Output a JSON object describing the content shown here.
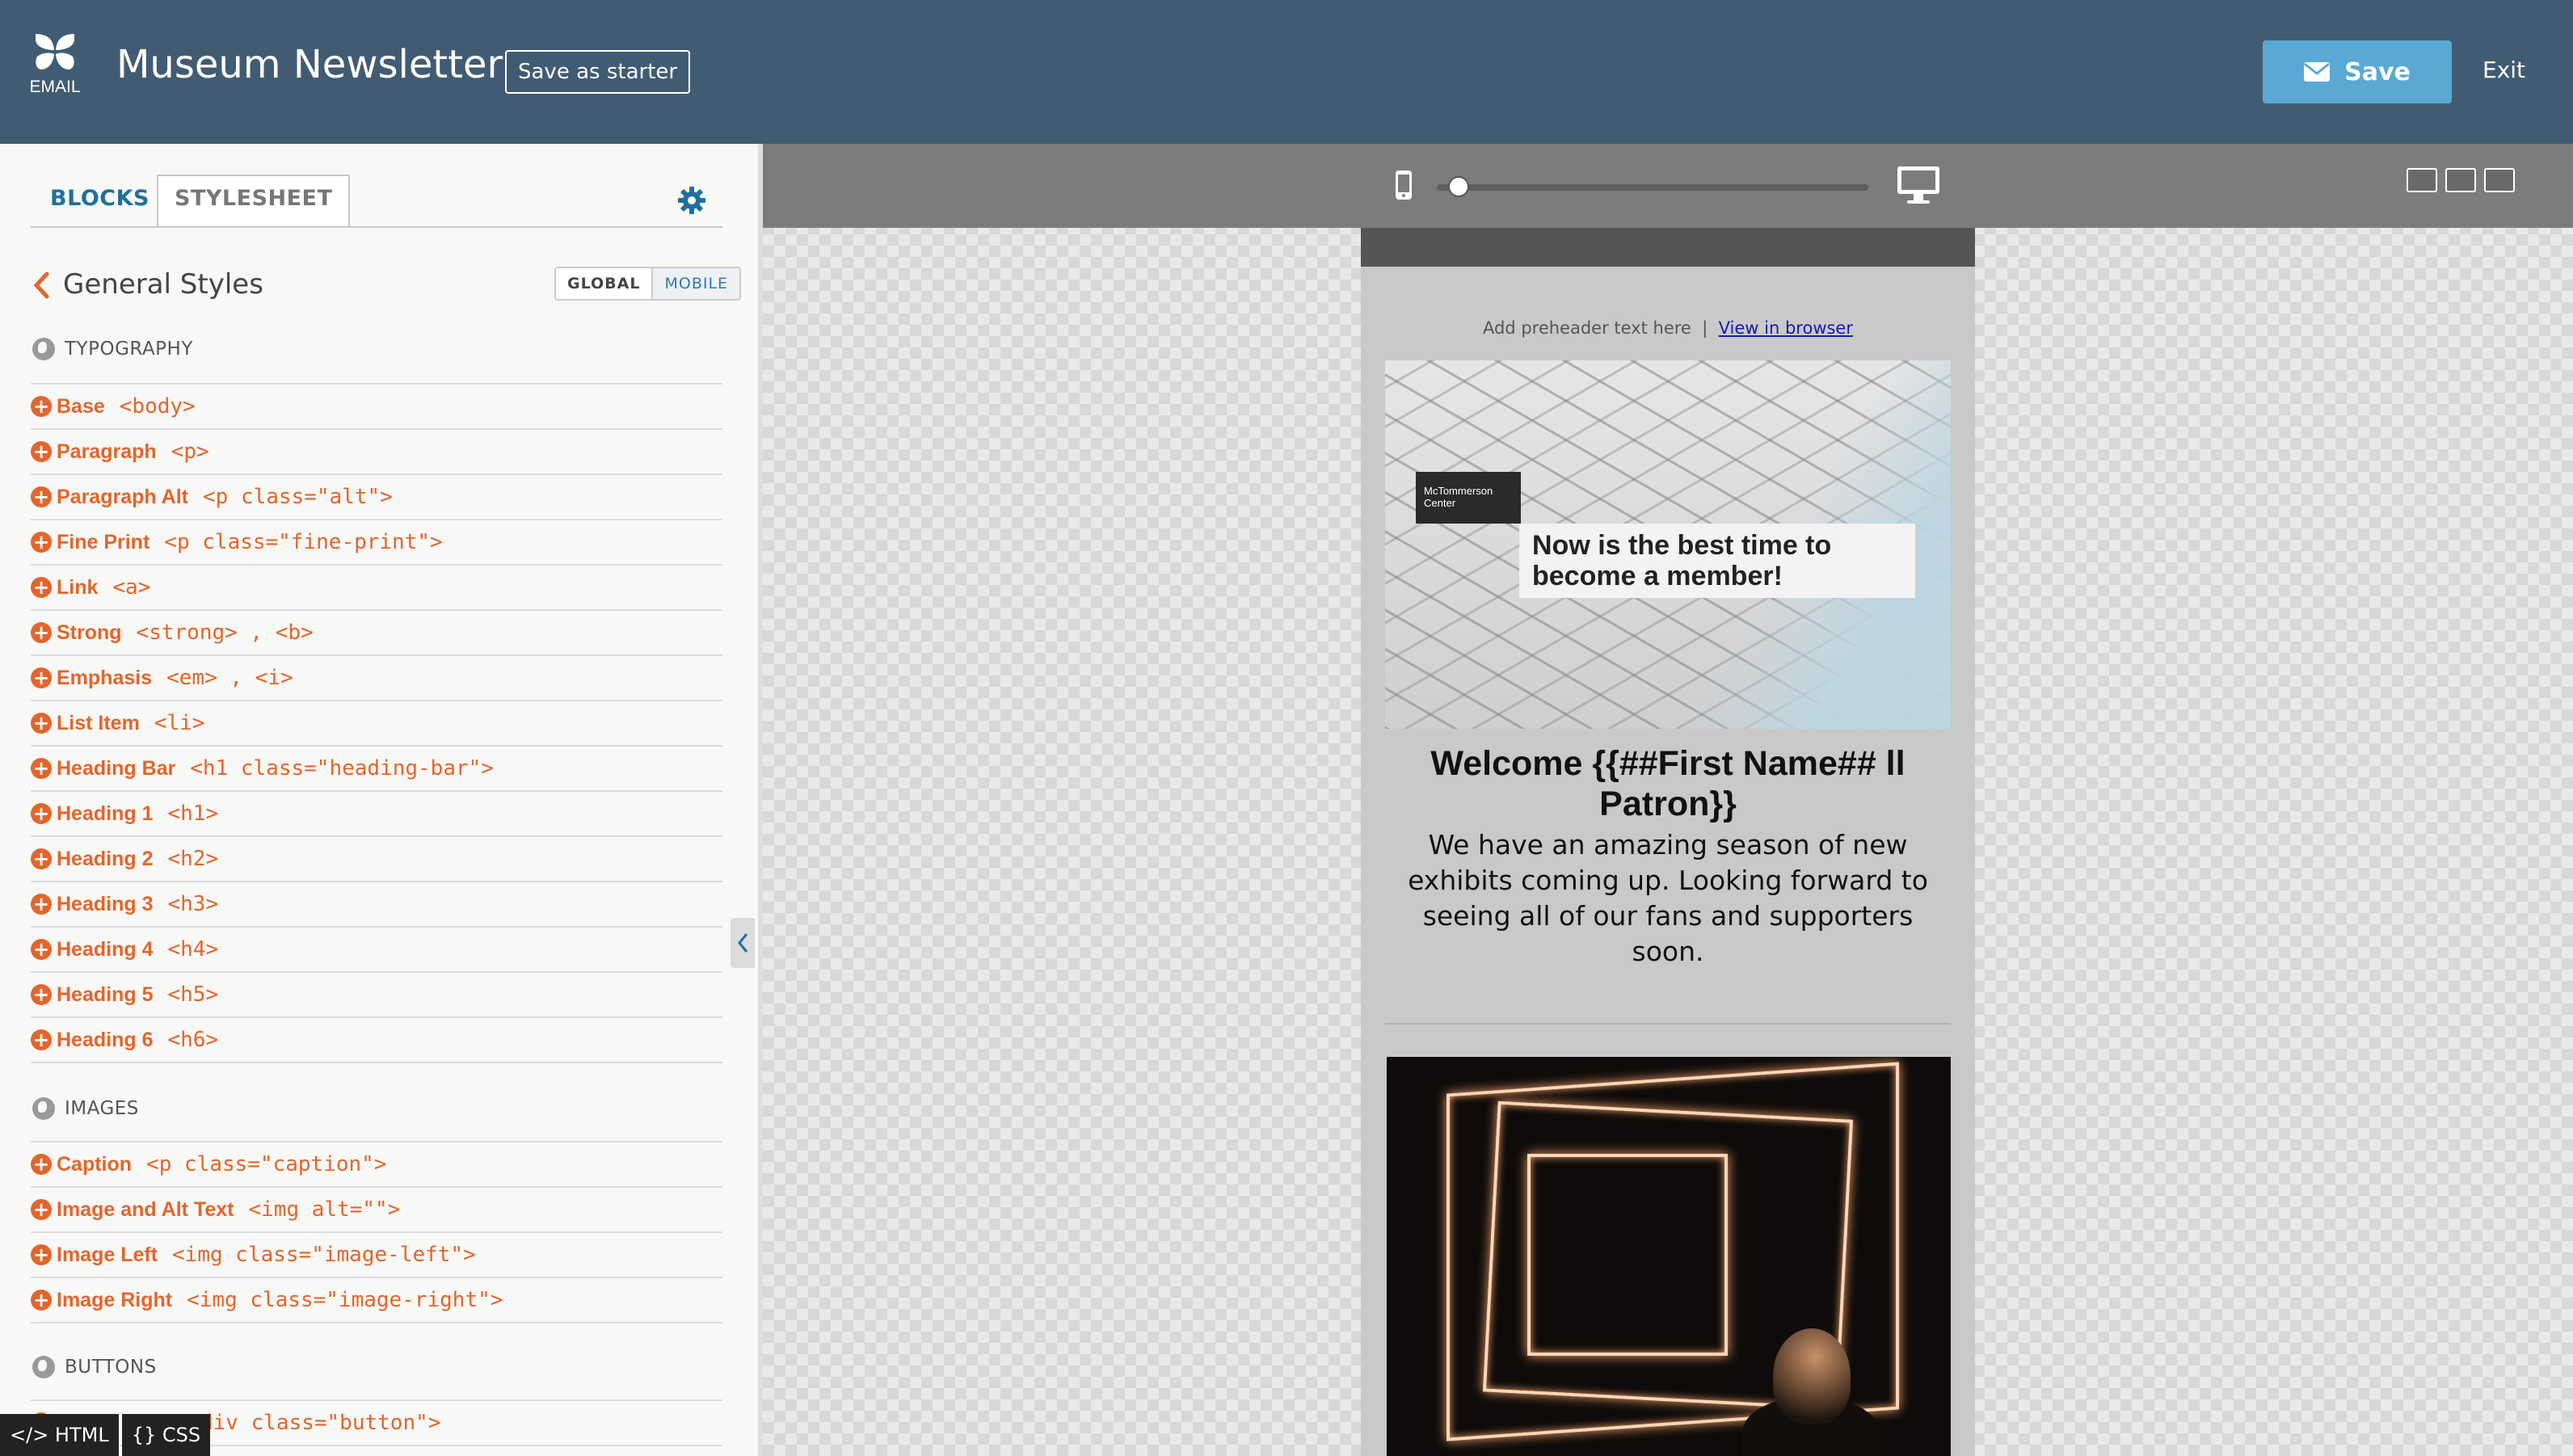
{
  "header": {
    "logo_label": "EMAIL",
    "title": "Museum Newsletter",
    "starter_button": "Save as starter",
    "save_button": "Save",
    "exit_link": "Exit",
    "bar_color": "#415c72",
    "save_color": "#5aa9d4"
  },
  "sidebar": {
    "tabs": [
      "BLOCKS",
      "STYLESHEET"
    ],
    "active_tab": "STYLESHEET",
    "panel_title": "General Styles",
    "scope_toggle": [
      "GLOBAL",
      "MOBILE"
    ],
    "accent_color": "#e4652b",
    "sections": [
      {
        "heading": "TYPOGRAPHY",
        "rows": [
          {
            "name": "Base",
            "tag": "<body>"
          },
          {
            "name": "Paragraph",
            "tag": "<p>"
          },
          {
            "name": "Paragraph Alt",
            "tag": "<p class=\"alt\">"
          },
          {
            "name": "Fine Print",
            "tag": "<p class=\"fine-print\">"
          },
          {
            "name": "Link",
            "tag": "<a>"
          },
          {
            "name": "Strong",
            "tag": "<strong> , <b>"
          },
          {
            "name": "Emphasis",
            "tag": "<em> , <i>"
          },
          {
            "name": "List Item",
            "tag": "<li>"
          },
          {
            "name": "Heading Bar",
            "tag": "<h1 class=\"heading-bar\">"
          },
          {
            "name": "Heading 1",
            "tag": "<h1>"
          },
          {
            "name": "Heading 2",
            "tag": "<h2>"
          },
          {
            "name": "Heading 3",
            "tag": "<h3>"
          },
          {
            "name": "Heading 4",
            "tag": "<h4>"
          },
          {
            "name": "Heading 5",
            "tag": "<h5>"
          },
          {
            "name": "Heading 6",
            "tag": "<h6>"
          }
        ]
      },
      {
        "heading": "IMAGES",
        "rows": [
          {
            "name": "Caption",
            "tag": "<p class=\"caption\">"
          },
          {
            "name": "Image and Alt Text",
            "tag": "<img alt=\"\">"
          },
          {
            "name": "Image Left",
            "tag": "<img class=\"image-left\">"
          },
          {
            "name": "Image Right",
            "tag": "<img class=\"image-right\">"
          }
        ]
      },
      {
        "heading": "BUTTONS",
        "rows": [
          {
            "name": "",
            "tag": "div class=\"button\">"
          }
        ]
      }
    ],
    "code_tabs": [
      "</> HTML",
      "{} CSS"
    ]
  },
  "preview": {
    "device_slider_value": 0.05,
    "email": {
      "preheader_text": "Add preheader text here",
      "preheader_sep": "|",
      "view_in_browser": "View in browser",
      "hero_tag": "McTommerson Center",
      "hero_headline": "Now is the best time to become a member!",
      "welcome": "Welcome {{##First Name## ll Patron}}",
      "body": "We have an amazing season of new exhibits coming up. Looking forward to seeing all of our fans and supporters soon."
    }
  }
}
